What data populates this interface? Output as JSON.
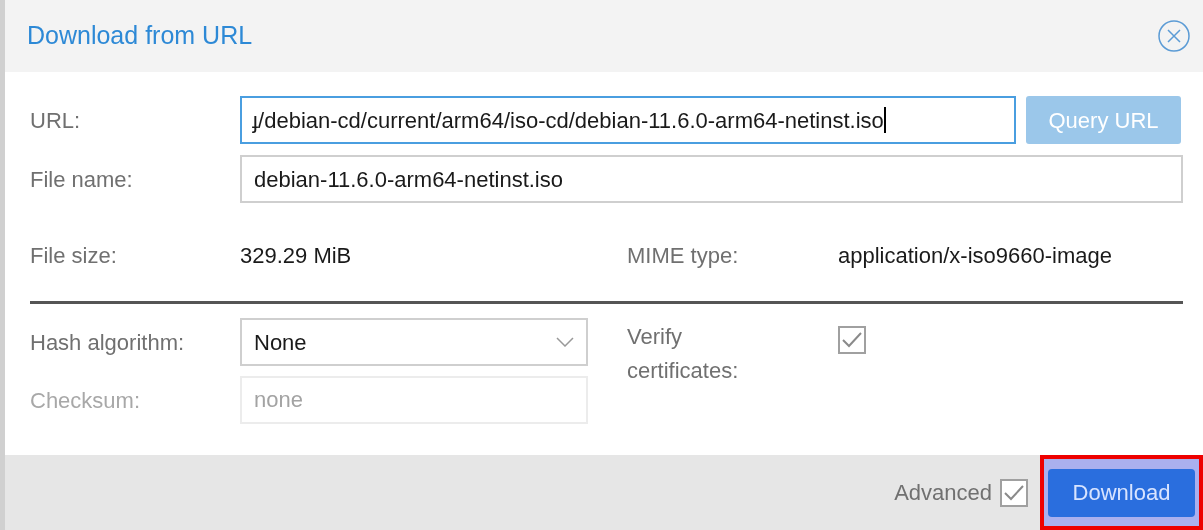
{
  "dialog": {
    "title": "Download from URL"
  },
  "url": {
    "label": "URL:",
    "value": "ɟ/debian-cd/current/arm64/iso-cd/debian-11.6.0-arm64-netinst.iso",
    "focused": true
  },
  "query_button": {
    "label": "Query URL",
    "disabled": true
  },
  "file_name": {
    "label": "File name:",
    "value": "debian-11.6.0-arm64-netinst.iso"
  },
  "file_size": {
    "label": "File size:",
    "value": "329.29 MiB"
  },
  "mime_type": {
    "label": "MIME type:",
    "value": "application/x-iso9660-image"
  },
  "hash_algorithm": {
    "label": "Hash algorithm:",
    "value": "None"
  },
  "checksum": {
    "label": "Checksum:",
    "placeholder": "none",
    "disabled": true
  },
  "verify_certificates": {
    "label": "Verify certificates:",
    "checked": true
  },
  "footer": {
    "advanced": {
      "label": "Advanced",
      "checked": true
    },
    "download_button": {
      "label": "Download",
      "highlighted": true
    }
  }
}
